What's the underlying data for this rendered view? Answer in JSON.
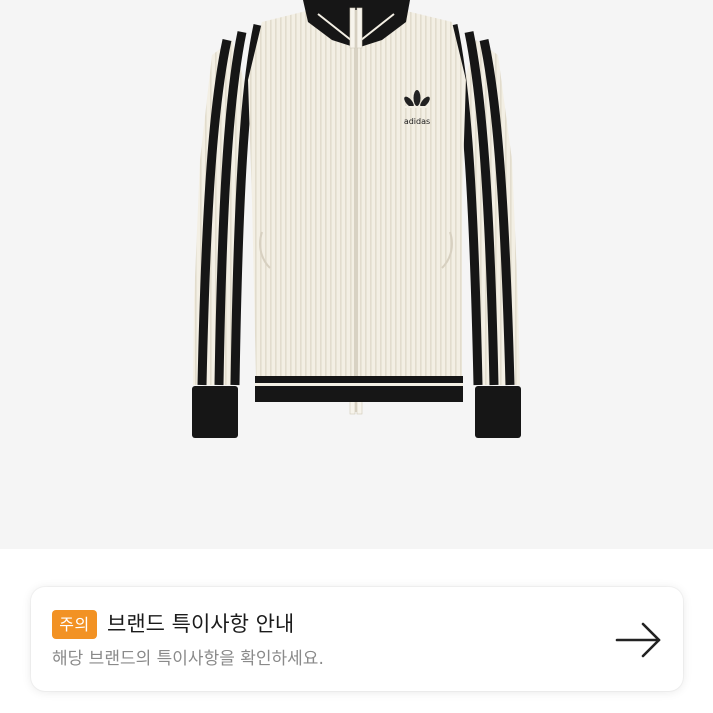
{
  "product": {
    "image_alt": "adidas white track jacket",
    "logo_text": "adidas"
  },
  "notice": {
    "badge_label": "주의",
    "title": "브랜드 특이사항 안내",
    "description": "해당 브랜드의 특이사항을 확인하세요.",
    "link_icon": "arrow-right-icon"
  },
  "colors": {
    "image_background": "#f5f5f5",
    "badge": "#f29224",
    "title_text": "#1b1b1b",
    "description_text": "#8a8a8a"
  }
}
